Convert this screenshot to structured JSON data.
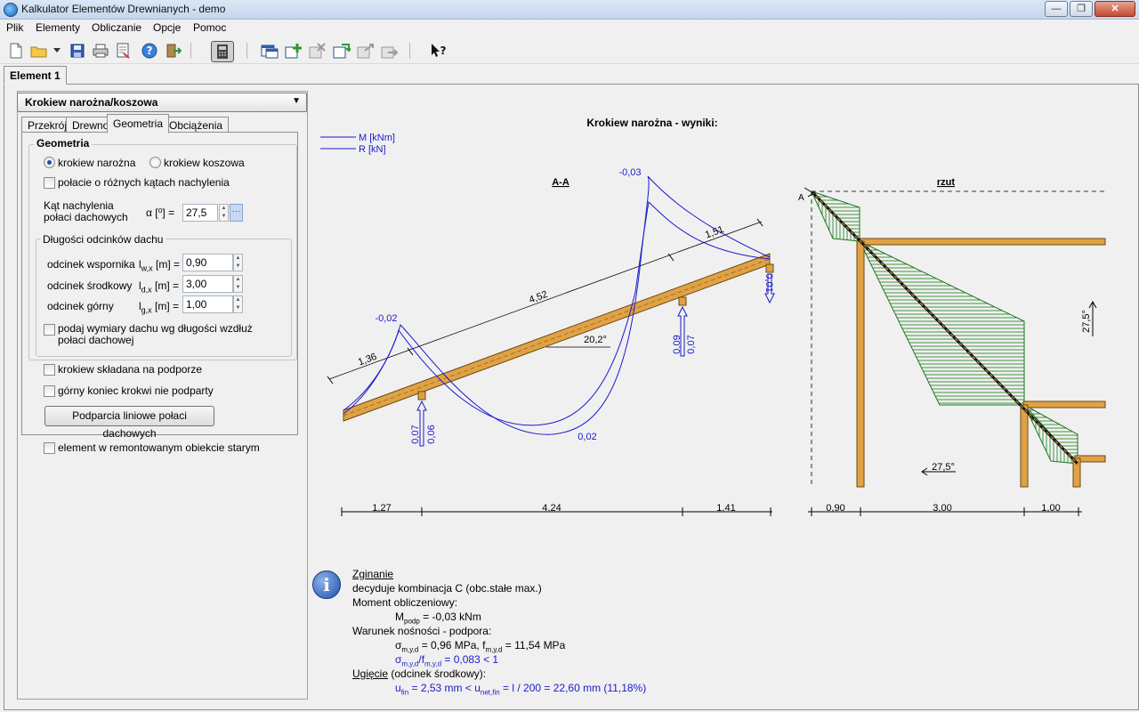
{
  "window": {
    "title": "Kalkulator Elementów Drewnianych - demo"
  },
  "menu": [
    "Plik",
    "Elementy",
    "Obliczanie",
    "Opcje",
    "Pomoc"
  ],
  "element_tab": "Element 1",
  "element_type": "Krokiew narożna/koszowa",
  "subtabs": [
    "Przekrój",
    "Drewno",
    "Geometria",
    "Obciążenia"
  ],
  "geometry": {
    "group_title": "Geometria",
    "radio1": "krokiew narożna",
    "radio2": "krokiew koszowa",
    "check_angles": "połacie o różnych kątach nachylenia",
    "angle_label": "Kąt nachylenia połaci dachowych",
    "angle_symbol": "α [⁰] =",
    "angle_value": "27,5",
    "lengths_title": "Długości odcinków dachu",
    "rows": [
      {
        "label": "odcinek wspornika",
        "sym": "l",
        "sub": "w,x",
        "unit": " [m] =",
        "value": "0,90"
      },
      {
        "label": "odcinek środkowy",
        "sym": "l",
        "sub": "d,x",
        "unit": " [m] =",
        "value": "3,00"
      },
      {
        "label": "odcinek górny",
        "sym": "l",
        "sub": "g,x",
        "unit": " [m] =",
        "value": "1,00"
      }
    ],
    "check_dims": "podaj wymiary dachu wg długości wzdłuż połaci dachowej",
    "check_spliced": "krokiew składana na podporze",
    "check_top": "górny koniec krokwi nie podparty",
    "button_supports": "Podparcia liniowe połaci dachowych",
    "check_old": "element w remontowanym obiekcie starym"
  },
  "diagram": {
    "title": "Krokiew narożna - wyniki:",
    "legend_m": "M [kNm]",
    "legend_r": "R [kN]",
    "section_label": "A-A",
    "plan_label": "rzut",
    "left_values": {
      "len_total": "4,52",
      "len_left": "1,36",
      "len_right": "1,51",
      "slope": "20,2°",
      "m_left": "-0,02",
      "m_mid": "0,02",
      "m_right": "-0,03",
      "r1a": "0,07",
      "r1b": "0,06",
      "r2a": "0,09",
      "r2b": "0,07",
      "r3": "0,01"
    },
    "left_dims": [
      "1,27",
      "4,24",
      "1,41"
    ],
    "right_dims": [
      "0,90",
      "3,00",
      "1,00"
    ],
    "plan_angle": "27,5°",
    "side_angle": "27,5°",
    "plan_marker": "A"
  },
  "info": {
    "heading": "Zginanie",
    "line1": "decyduje kombinacja C (obc.stałe max.)",
    "line2": "Moment obliczeniowy:",
    "mpodp": "= -0,03 kNm",
    "line3": "Warunek nośności - podpora:",
    "stress": "= 0,96 MPa,",
    "strength": "= 11,54 MPa",
    "ratio": "= 0,083  <  1",
    "ugiecie": "Ugięcie",
    "ug_tail": " (odcinek środkowy):",
    "ufin": "= 2,53 mm  <",
    "unet": "= l / 200 = 22,60 mm     (11,18%)"
  },
  "colors": {
    "accent": "#1e5bb8",
    "wood": "#e0a244",
    "hatch": "#1a7a1a",
    "blue": "#1a1acc"
  }
}
